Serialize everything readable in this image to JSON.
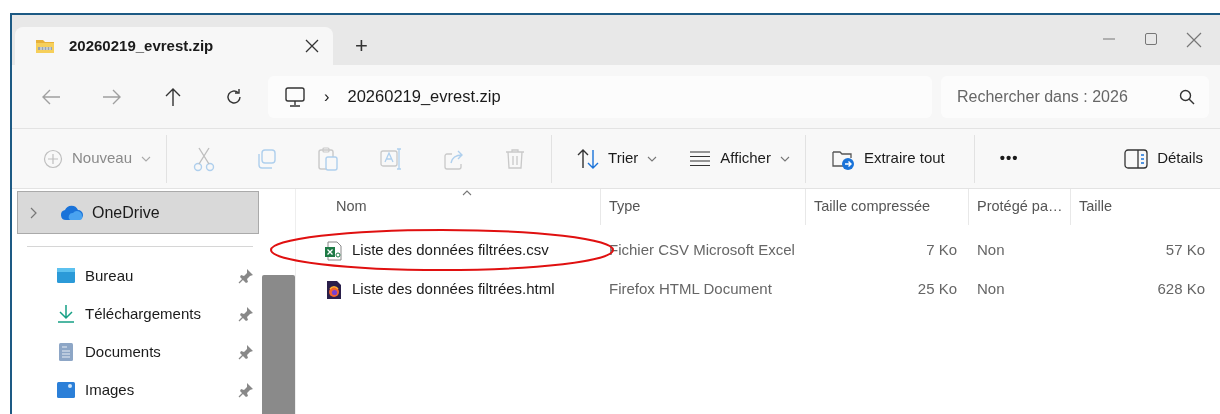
{
  "window": {
    "tabs": [
      {
        "title": "20260219_evrest.zip",
        "selected": true
      }
    ],
    "new_tab": "+"
  },
  "navigation": [
    {
      "kind": "back",
      "disabled": true
    },
    {
      "kind": "forward",
      "disabled": true
    },
    {
      "kind": "up",
      "disabled": false
    },
    {
      "kind": "refresh",
      "disabled": false
    }
  ],
  "address": {
    "separator": "›",
    "segments": [
      "20260219_evrest.zip"
    ]
  },
  "search": {
    "placeholder": "Rechercher dans : 2026"
  },
  "toolbar": [
    {
      "kind": "new",
      "label": "Nouveau",
      "disabled": true,
      "dropdown": true
    },
    {
      "kind": "divider"
    },
    {
      "kind": "cut",
      "disabled": true
    },
    {
      "kind": "copy",
      "disabled": true
    },
    {
      "kind": "paste",
      "disabled": true
    },
    {
      "kind": "rename",
      "disabled": true
    },
    {
      "kind": "share",
      "disabled": true
    },
    {
      "kind": "delete",
      "disabled": true
    },
    {
      "kind": "divider"
    },
    {
      "kind": "sort",
      "label": "Trier",
      "disabled": false,
      "dropdown": true
    },
    {
      "kind": "view",
      "label": "Afficher",
      "disabled": false,
      "dropdown": true
    },
    {
      "kind": "divider"
    },
    {
      "kind": "extract",
      "label": "Extraire tout",
      "disabled": false,
      "dropdown": false
    },
    {
      "kind": "divider"
    },
    {
      "kind": "more",
      "label": "•••",
      "disabled": false,
      "dropdown": false
    },
    {
      "kind": "details",
      "label": "Détails",
      "disabled": false,
      "dropdown": false
    }
  ],
  "sidebar": {
    "top": [
      {
        "label": "OneDrive",
        "kind": "cloud",
        "selected": true
      }
    ],
    "quick_access": [
      {
        "label": "Bureau",
        "kind": "desktop",
        "pinned": true
      },
      {
        "label": "Téléchargements",
        "kind": "downloads",
        "pinned": true
      },
      {
        "label": "Documents",
        "kind": "documents",
        "pinned": true
      },
      {
        "label": "Images",
        "kind": "pictures",
        "pinned": true
      }
    ]
  },
  "table": {
    "columns": [
      {
        "label": "Nom",
        "sorted": true
      },
      {
        "label": "Type",
        "sorted": false
      },
      {
        "label": "Taille compressée",
        "sorted": false
      },
      {
        "label": "Protégé pa…",
        "sorted": false
      },
      {
        "label": "Taille",
        "sorted": false
      }
    ],
    "rows": [
      {
        "kind": "csv",
        "circled": true,
        "cells": [
          "Liste des données filtrées.csv",
          "Fichier CSV Microsoft Excel",
          "7 Ko",
          "Non",
          "57 Ko"
        ]
      },
      {
        "kind": "html",
        "circled": false,
        "cells": [
          "Liste des données filtrées.html",
          "Firefox HTML Document",
          "25 Ko",
          "Non",
          "628 Ko"
        ]
      }
    ]
  }
}
